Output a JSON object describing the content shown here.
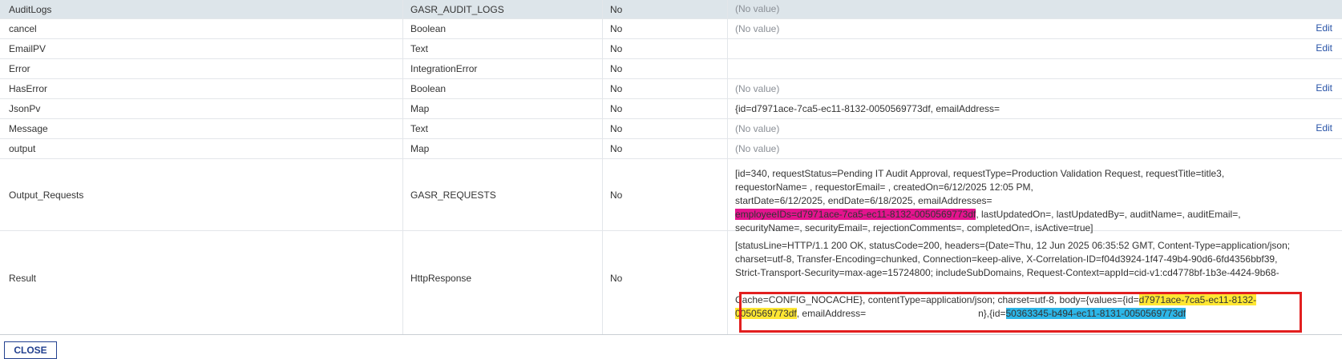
{
  "rows": [
    {
      "name": "AuditLogs",
      "type": "GASR_AUDIT_LOGS",
      "required": "No",
      "value": "(No value)",
      "edit": ""
    },
    {
      "name": "cancel",
      "type": "Boolean",
      "required": "No",
      "value": "(No value)",
      "edit": "Edit"
    },
    {
      "name": "EmailPV",
      "type": "Text",
      "required": "No",
      "value": "",
      "edit": "Edit"
    },
    {
      "name": "Error",
      "type": "IntegrationError",
      "required": "No",
      "value": "",
      "edit": ""
    },
    {
      "name": "HasError",
      "type": "Boolean",
      "required": "No",
      "value": "(No value)",
      "edit": "Edit"
    },
    {
      "name": "JsonPv",
      "type": "Map",
      "required": "No",
      "value": "{id=d7971ace-7ca5-ec11-8132-0050569773df, emailAddress=",
      "edit": ""
    },
    {
      "name": "Message",
      "type": "Text",
      "required": "No",
      "value": "(No value)",
      "edit": "Edit"
    },
    {
      "name": "output",
      "type": "Map",
      "required": "No",
      "value": "(No value)",
      "edit": ""
    },
    {
      "name": "Output_Requests",
      "type": "GASR_REQUESTS",
      "required": "No",
      "value_lines": [
        "[id=340, requestStatus=Pending IT Audit Approval, requestType=Production Validation Request, requestTitle=title3,",
        "requestorName=                              , requestorEmail=                            , createdOn=6/12/2025 12:05 PM,",
        "startDate=6/12/2025, endDate=6/18/2025, emailAddresses=",
        "securityName=, securityEmail=, rejectionComments=, completedOn=, isActive=true]"
      ],
      "value_highlight": "employeeIDs=d7971ace-7ca5-ec11-8132-0050569773df",
      "value_after_highlight": ", lastUpdatedOn=, lastUpdatedBy=, auditName=, auditEmail=,",
      "edit": ""
    },
    {
      "name": "Result",
      "type": "HttpResponse",
      "required": "No",
      "value_lines": [
        "[statusLine=HTTP/1.1 200 OK, statusCode=200, headers={Date=Thu, 12 Jun 2025 06:35:52 GMT, Content-Type=application/json;",
        "charset=utf-8, Transfer-Encoding=chunked, Connection=keep-alive, X-Correlation-ID=f04d3924-1f47-49b4-90d6-6fd4356bbf39,",
        "Strict-Transport-Security=max-age=15724800; includeSubDomains, Request-Context=appId=cid-v1:cd4778bf-1b3e-4424-9b68-",
        "Cache=CONFIG_NOCACHE}, contentType=application/json; charset=utf-8, body={values={id=",
        "d7971ace-7ca5-ec11-8132-",
        "0050569773df",
        ", emailAddress=",
        "n},{id=",
        "50363345-b494-ec11-8131-0050569773df"
      ],
      "edit": ""
    }
  ],
  "close_label": "CLOSE",
  "colors": {
    "header_bg": "#dde5ea",
    "link": "#2a55a8",
    "highlight_pink": "#e4138e",
    "highlight_yellow": "#ffe733",
    "highlight_blue": "#2cb6e8",
    "annotation_red": "#e21f1f"
  }
}
